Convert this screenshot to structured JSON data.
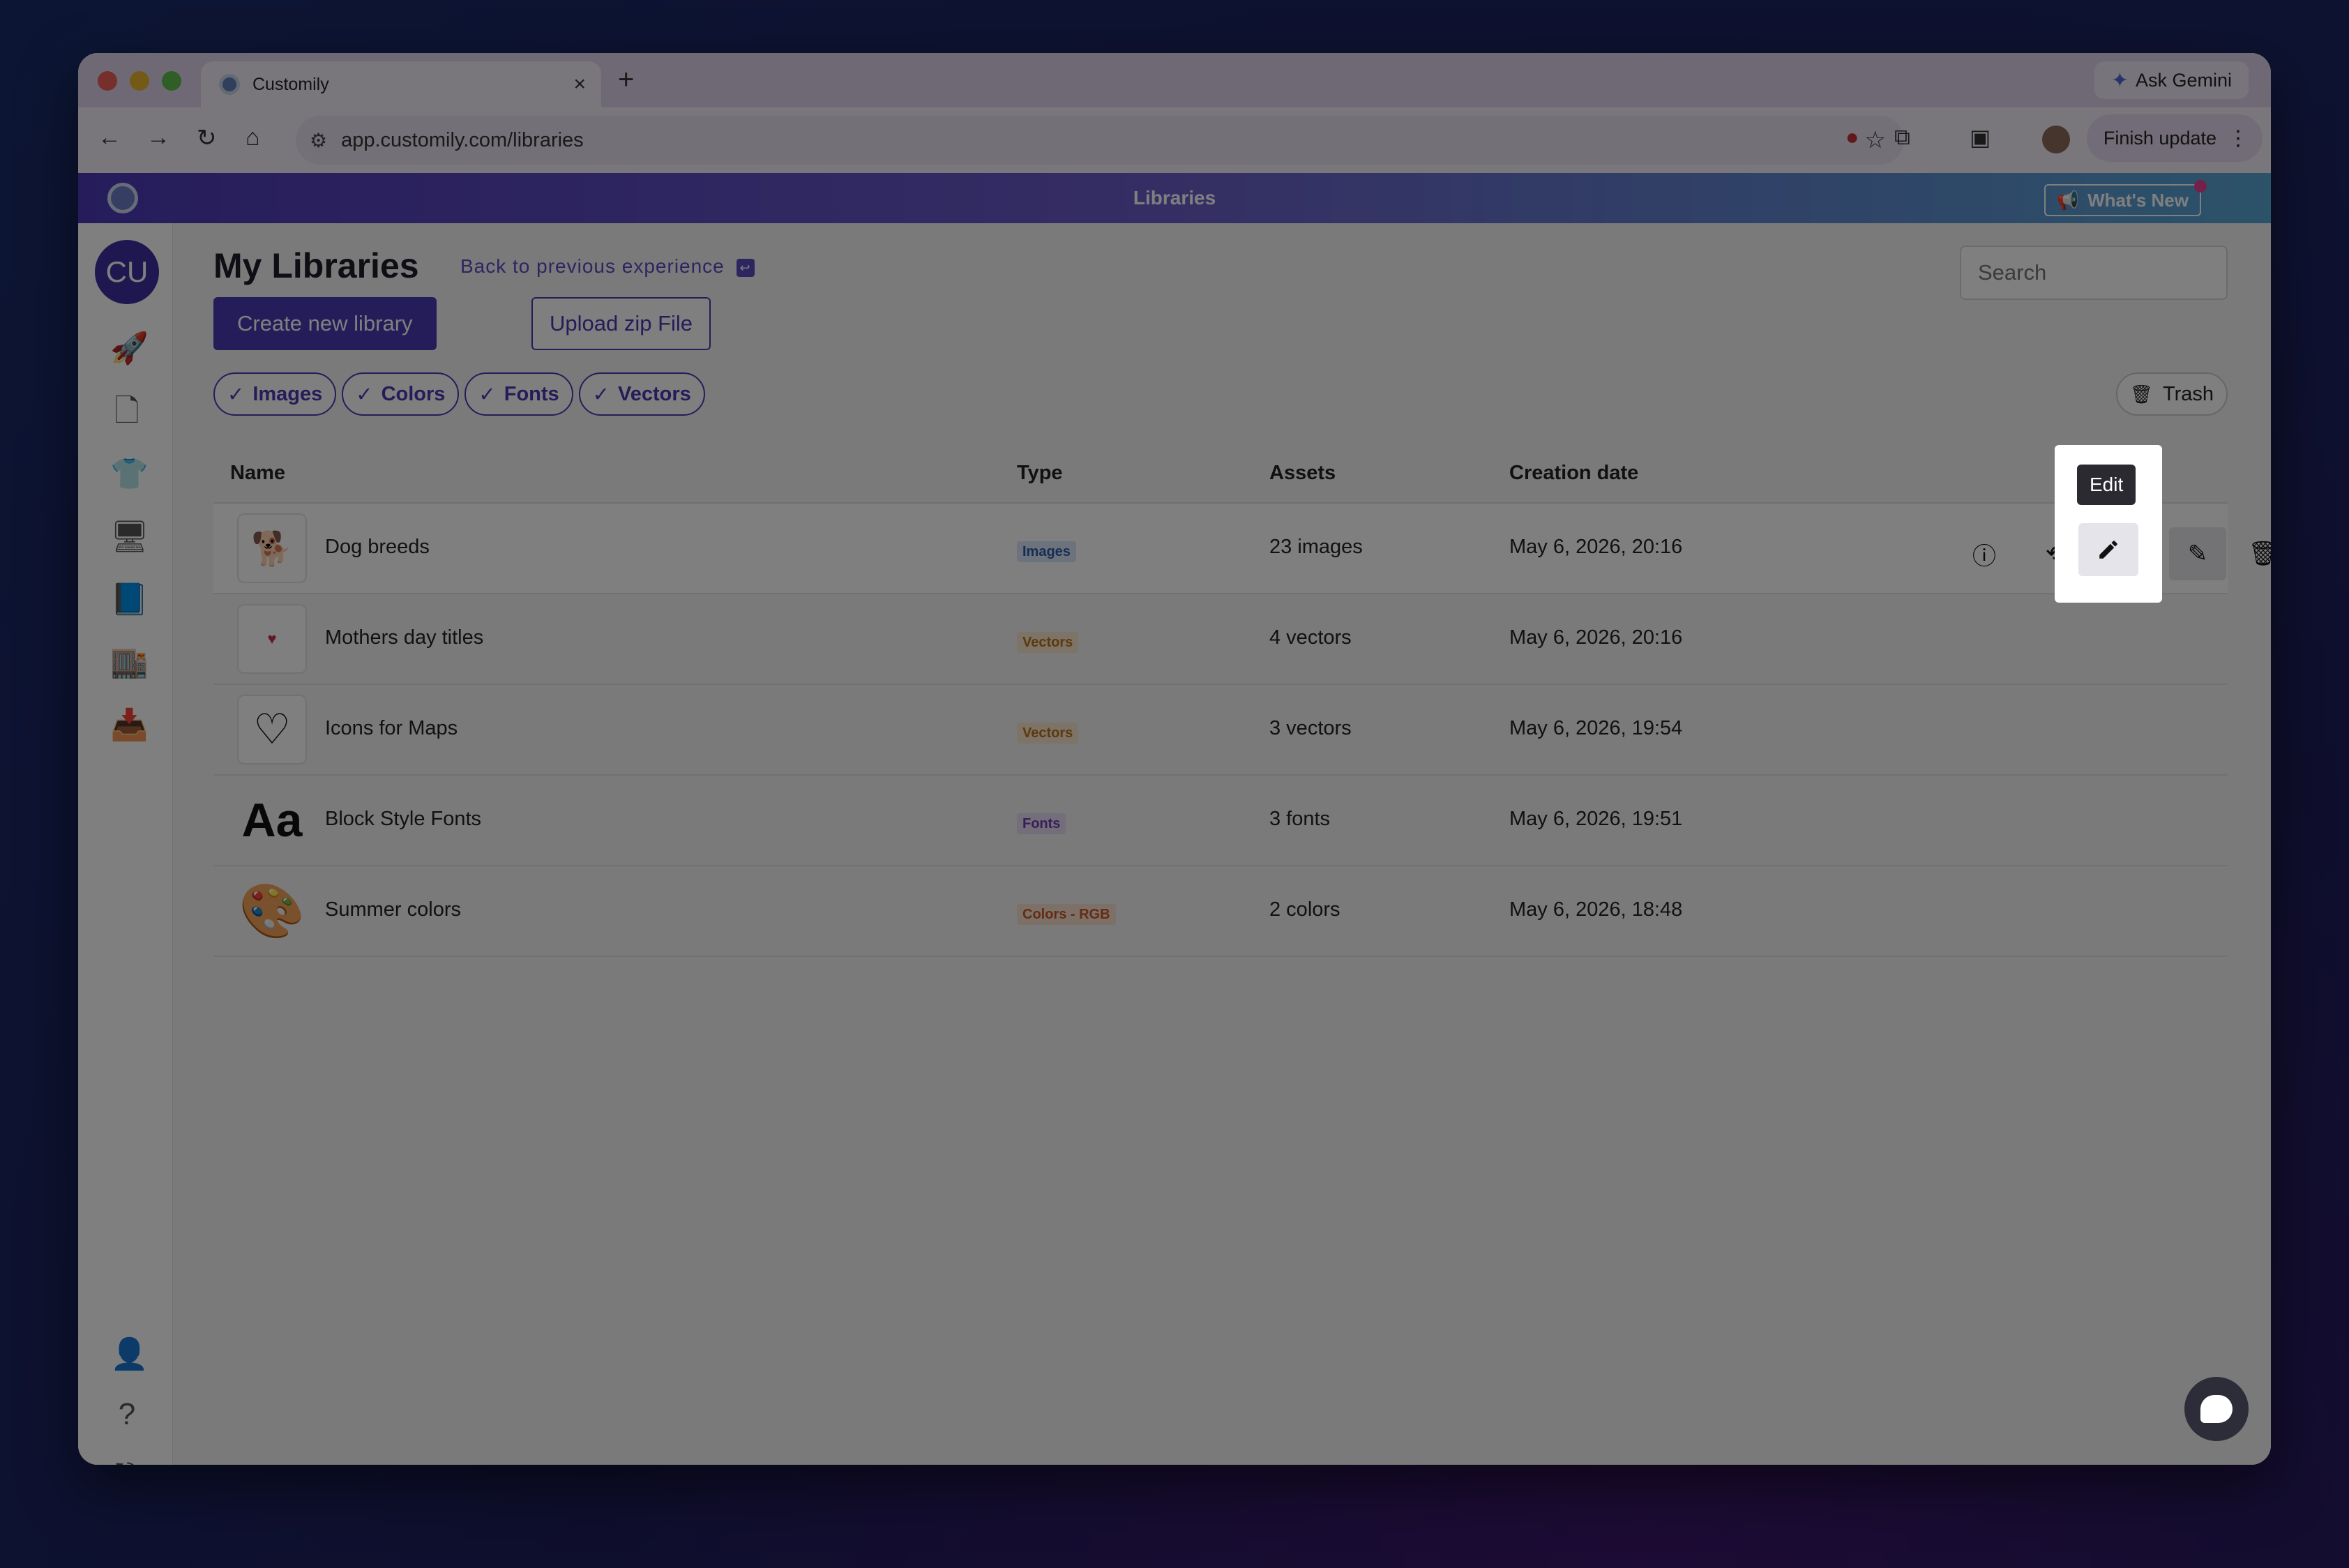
{
  "browser": {
    "tab_title": "Customily",
    "tab_close": "×",
    "new_tab": "+",
    "gemini_label": "Ask Gemini",
    "url": "app.customily.com/libraries",
    "finish_update": "Finish update"
  },
  "app": {
    "page_title": "Libraries",
    "whats_new": "What's New",
    "avatar_initials": "CU"
  },
  "main": {
    "heading": "My Libraries",
    "back_link": "Back to previous experience",
    "search_placeholder": "Search",
    "create_button": "Create new library",
    "upload_button": "Upload zip File",
    "filters": [
      "Images",
      "Colors",
      "Fonts",
      "Vectors"
    ],
    "trash_label": "Trash"
  },
  "table": {
    "headers": {
      "name": "Name",
      "type": "Type",
      "assets": "Assets",
      "date": "Creation date"
    },
    "rows": [
      {
        "name": "Dog breeds",
        "type": "Images",
        "assets": "23 images",
        "date": "May 6, 2026, 20:16"
      },
      {
        "name": "Mothers day titles",
        "type": "Vectors",
        "assets": "4 vectors",
        "date": "May 6, 2026, 20:16"
      },
      {
        "name": "Icons for Maps",
        "type": "Vectors",
        "assets": "3 vectors",
        "date": "May 6, 2026, 19:54"
      },
      {
        "name": "Block Style Fonts",
        "type": "Fonts",
        "assets": "3 fonts",
        "date": "May 6, 2026, 19:51",
        "thumb_text": "Aa"
      },
      {
        "name": "Summer colors",
        "type": "Colors - RGB",
        "assets": "2 colors",
        "date": "May 6, 2026, 18:48"
      }
    ]
  },
  "tooltip": {
    "edit": "Edit"
  },
  "colors": {
    "accent": "#4a3bb3"
  }
}
